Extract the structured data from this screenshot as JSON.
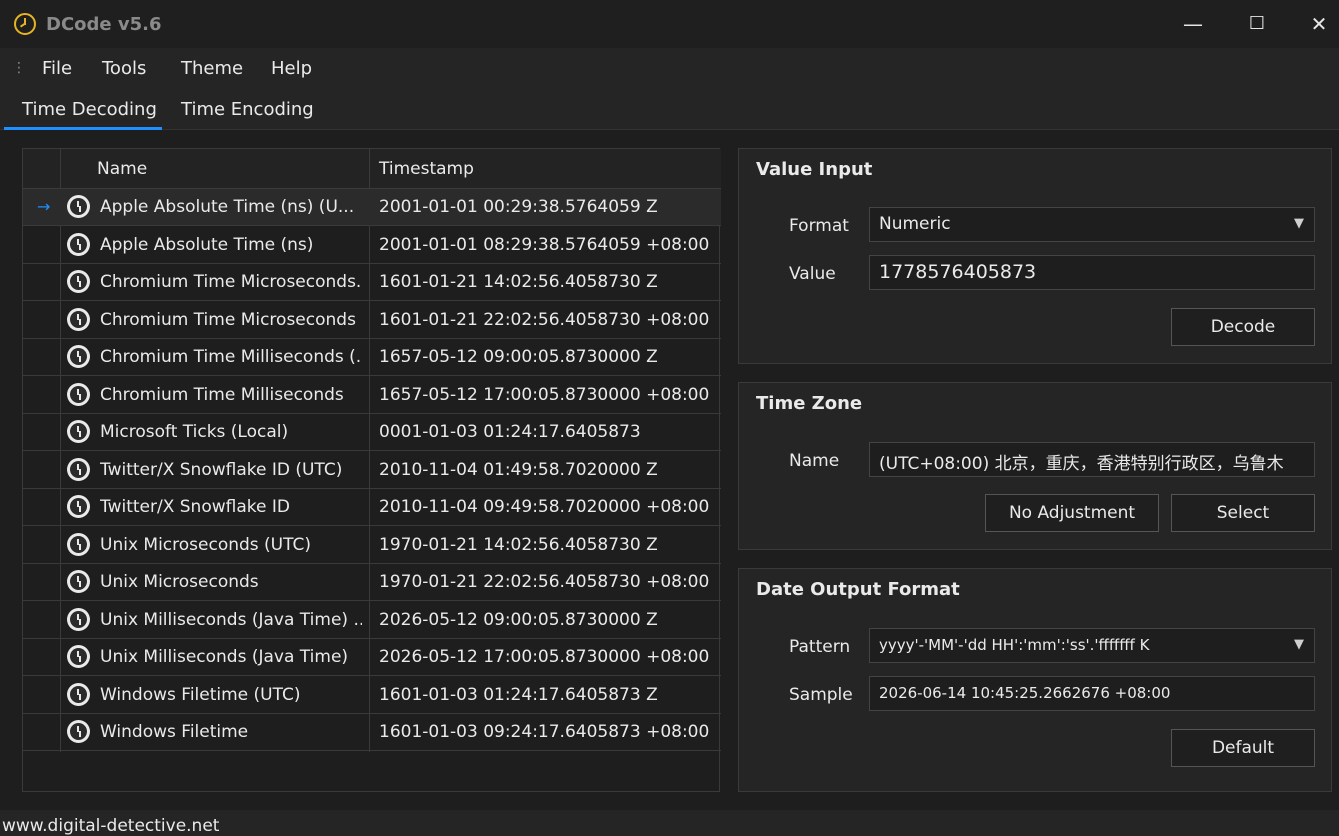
{
  "window": {
    "title": "DCode v5.6",
    "minimize_glyph": "—",
    "maximize_glyph": "☐",
    "close_glyph": "✕"
  },
  "menu": [
    "File",
    "Tools",
    "Theme",
    "Help"
  ],
  "tabs": [
    "Time Decoding",
    "Time Encoding"
  ],
  "grid": {
    "headers": [
      "Name",
      "Timestamp"
    ],
    "selected_marker": "→",
    "rows": [
      {
        "name": "Apple Absolute Time (ns) (U...",
        "timestamp": "2001-01-01 00:29:38.5764059 Z"
      },
      {
        "name": "Apple Absolute Time (ns)",
        "timestamp": "2001-01-01 08:29:38.5764059 +08:00"
      },
      {
        "name": "Chromium Time Microseconds...",
        "timestamp": "1601-01-21 14:02:56.4058730 Z"
      },
      {
        "name": "Chromium Time Microseconds",
        "timestamp": "1601-01-21 22:02:56.4058730 +08:00"
      },
      {
        "name": "Chromium Time Milliseconds (...",
        "timestamp": "1657-05-12 09:00:05.8730000 Z"
      },
      {
        "name": "Chromium Time Milliseconds",
        "timestamp": "1657-05-12 17:00:05.8730000 +08:00"
      },
      {
        "name": "Microsoft Ticks (Local)",
        "timestamp": "0001-01-03 01:24:17.6405873"
      },
      {
        "name": "Twitter/X Snowflake ID (UTC)",
        "timestamp": "2010-11-04 01:49:58.7020000 Z"
      },
      {
        "name": "Twitter/X Snowflake ID",
        "timestamp": "2010-11-04 09:49:58.7020000 +08:00"
      },
      {
        "name": "Unix Microseconds (UTC)",
        "timestamp": "1970-01-21 14:02:56.4058730 Z"
      },
      {
        "name": "Unix Microseconds",
        "timestamp": "1970-01-21 22:02:56.4058730 +08:00"
      },
      {
        "name": "Unix Milliseconds (Java Time) ...",
        "timestamp": "2026-05-12 09:00:05.8730000 Z"
      },
      {
        "name": "Unix Milliseconds (Java Time)",
        "timestamp": "2026-05-12 17:00:05.8730000 +08:00"
      },
      {
        "name": "Windows Filetime (UTC)",
        "timestamp": "1601-01-03 01:24:17.6405873 Z"
      },
      {
        "name": "Windows Filetime",
        "timestamp": "1601-01-03 09:24:17.6405873 +08:00"
      }
    ]
  },
  "value_input": {
    "title": "Value Input",
    "format_label": "Format",
    "format_value": "Numeric",
    "value_label": "Value",
    "value": "1778576405873",
    "decode_button": "Decode"
  },
  "time_zone": {
    "title": "Time Zone",
    "name_label": "Name",
    "name_value": "(UTC+08:00) 北京，重庆，香港特别行政区，乌鲁木",
    "no_adjustment_button": "No Adjustment",
    "select_button": "Select"
  },
  "date_output": {
    "title": "Date Output Format",
    "pattern_label": "Pattern",
    "pattern_value": "yyyy'-'MM'-'dd HH':'mm':'ss'.'fffffff K",
    "sample_label": "Sample",
    "sample_value": "2026-06-14 10:45:25.2662676 +08:00",
    "default_button": "Default"
  },
  "status": {
    "text": "www.digital-detective.net"
  }
}
